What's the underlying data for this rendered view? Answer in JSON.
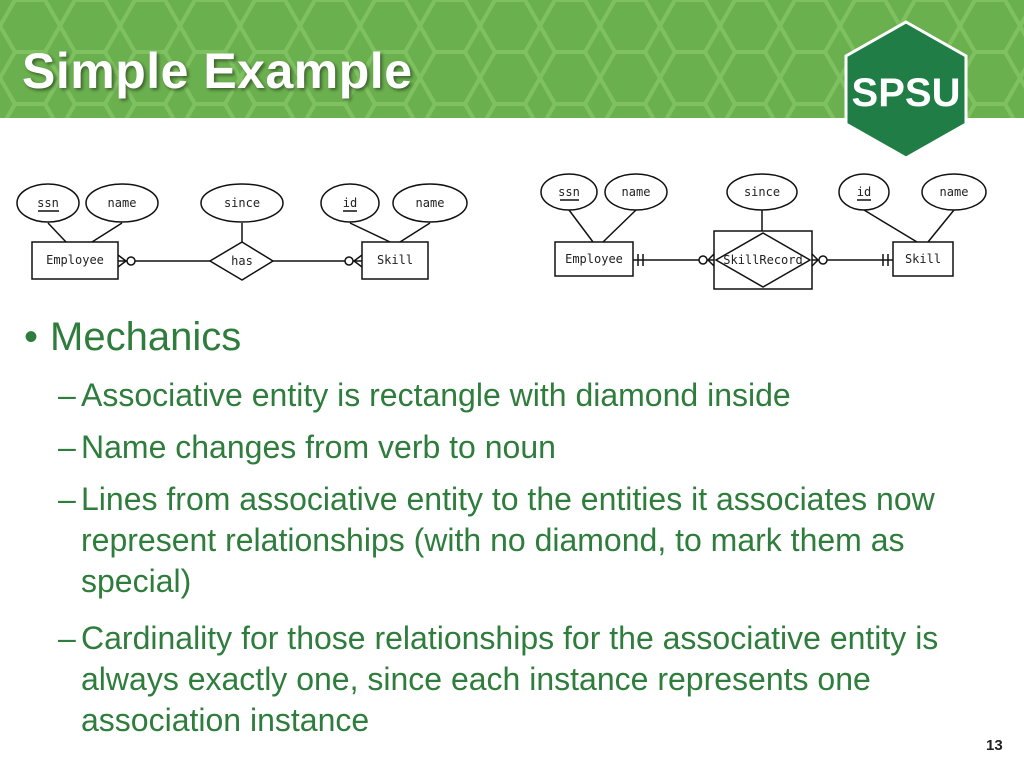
{
  "slide": {
    "title": "Simple Example",
    "logo_text": "SPSU",
    "page_number": "13"
  },
  "diagram_left": {
    "entities": [
      "Employee",
      "Skill"
    ],
    "relationship": "has",
    "attributes": {
      "employee": [
        "ssn",
        "name"
      ],
      "relationship": [
        "since"
      ],
      "skill": [
        "id",
        "name"
      ]
    },
    "keys": [
      "ssn",
      "id"
    ]
  },
  "diagram_right": {
    "entities": [
      "Employee",
      "Skill"
    ],
    "associative_entity": "SkillRecord",
    "attributes": {
      "employee": [
        "ssn",
        "name"
      ],
      "associative": [
        "since"
      ],
      "skill": [
        "id",
        "name"
      ]
    },
    "keys": [
      "ssn",
      "id"
    ]
  },
  "bullets": {
    "main": "Mechanics",
    "sub": [
      "Associative entity is rectangle with diamond inside",
      "Name changes from verb to noun",
      "Lines from associative entity to the entities it associates now represent relationships (with no diamond, to mark them as special)",
      "Cardinality for those relationships for the associative entity is always exactly one, since each instance represents one association instance"
    ]
  },
  "colors": {
    "banner": "#6bb04f",
    "logo": "#1f7d45",
    "text": "#2f7d3c"
  }
}
